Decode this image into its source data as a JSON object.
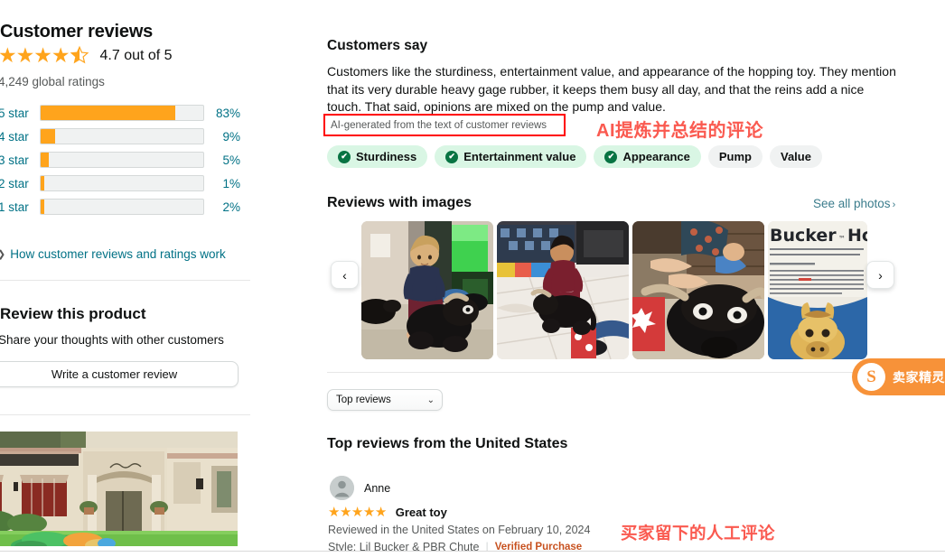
{
  "sidebar": {
    "title": "Customer reviews",
    "rating_value": "4.7 out of 5",
    "stars_filled": 4,
    "stars_half": 1,
    "global_ratings": "4,249 global ratings",
    "histogram": [
      {
        "label": "5 star",
        "percent": "83%",
        "value": 83
      },
      {
        "label": "4 star",
        "percent": "9%",
        "value": 9
      },
      {
        "label": "3 star",
        "percent": "5%",
        "value": 5
      },
      {
        "label": "2 star",
        "percent": "1%",
        "value": 1
      },
      {
        "label": "1 star",
        "percent": "2%",
        "value": 2
      }
    ],
    "how_link": "How customer reviews and ratings work",
    "review_product_title": "Review this product",
    "review_product_sub": "Share your thoughts with other customers",
    "write_review_button": "Write a customer review"
  },
  "customers_say": {
    "heading": "Customers say",
    "summary": "Customers like the sturdiness, entertainment value, and appearance of the hopping toy. They mention that its very durable heavy gage rubber, it keeps them busy all day, and that the reins add a nice touch. That said, opinions are mixed on the pump and value.",
    "ai_note": "AI-generated from the text of customer reviews",
    "chips": [
      {
        "label": "Sturdiness",
        "positive": true
      },
      {
        "label": "Entertainment value",
        "positive": true
      },
      {
        "label": "Appearance",
        "positive": true
      },
      {
        "label": "Pump",
        "positive": false
      },
      {
        "label": "Value",
        "positive": false
      }
    ]
  },
  "reviews_with_images": {
    "heading": "Reviews with images",
    "see_all": "See all photos",
    "see_all_arrow": "›",
    "prev_arrow": "‹",
    "next_arrow": "›",
    "thumb_caption_4": "Bucker™ Hor"
  },
  "sort": {
    "selected": "Top reviews",
    "chevron": "⌄"
  },
  "top_reviews": {
    "heading": "Top reviews from the United States",
    "reviews": [
      {
        "name": "Anne",
        "stars": 5,
        "title": "Great toy",
        "meta": "Reviewed in the United States on February 10, 2024",
        "style": "Style: Lil Bucker & PBR Chute",
        "verified": "Verified Purchase"
      }
    ]
  },
  "annotations": {
    "ai_summary_note": "AI提炼并总结的评论",
    "human_review_note": "买家留下的人工评论",
    "color": "#FA5A50"
  },
  "seller_badge": {
    "logo": "S",
    "text": "卖家精灵",
    "color": "#F79239"
  },
  "colors": {
    "star": "#FFA41C",
    "link": "#007185",
    "chip_positive_bg": "#D9F6E4",
    "chip_neutral_bg": "#F0F2F2",
    "check_green": "#087443",
    "verified_orange": "#C7511F",
    "annotation_red": "#FF0000"
  }
}
